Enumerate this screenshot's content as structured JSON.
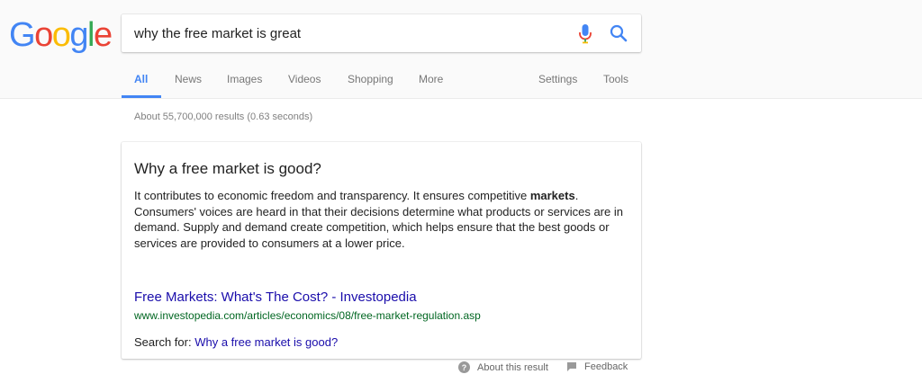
{
  "header": {
    "logo_letters": [
      "G",
      "o",
      "o",
      "g",
      "l",
      "e"
    ],
    "logo_colors": [
      "#4285f4",
      "#ea4335",
      "#fbbc05",
      "#4285f4",
      "#34a853",
      "#ea4335"
    ],
    "search_value": "why the free market is great",
    "icons": {
      "mic": "microphone-icon",
      "search": "search-icon"
    }
  },
  "tabs": {
    "all": "All",
    "news": "News",
    "images": "Images",
    "videos": "Videos",
    "shopping": "Shopping",
    "more": "More",
    "settings": "Settings",
    "tools": "Tools"
  },
  "stats": "About 55,700,000 results (0.63 seconds)",
  "snippet": {
    "title": "Why a free market is good?",
    "body_before": "It contributes to economic freedom and transparency. It ensures competitive ",
    "body_bold": "markets",
    "body_after": ". Consumers' voices are heard in that their decisions determine what products or services are in demand. Supply and demand create competition, which helps ensure that the best goods or services are provided to consumers at a lower price.",
    "link_text": "Free Markets: What's The Cost? - Investopedia",
    "url": "www.investopedia.com/articles/economics/08/free-market-regulation.asp",
    "search_for_label": "Search for:",
    "search_for_link": "Why a free market is good?"
  },
  "footer": {
    "about": "About this result",
    "feedback": "Feedback",
    "icons": {
      "about": "help-circle-icon",
      "feedback": "feedback-flag-icon"
    }
  },
  "colors": {
    "accent": "#4285f4",
    "link": "#1a0dab",
    "url": "#006621"
  }
}
